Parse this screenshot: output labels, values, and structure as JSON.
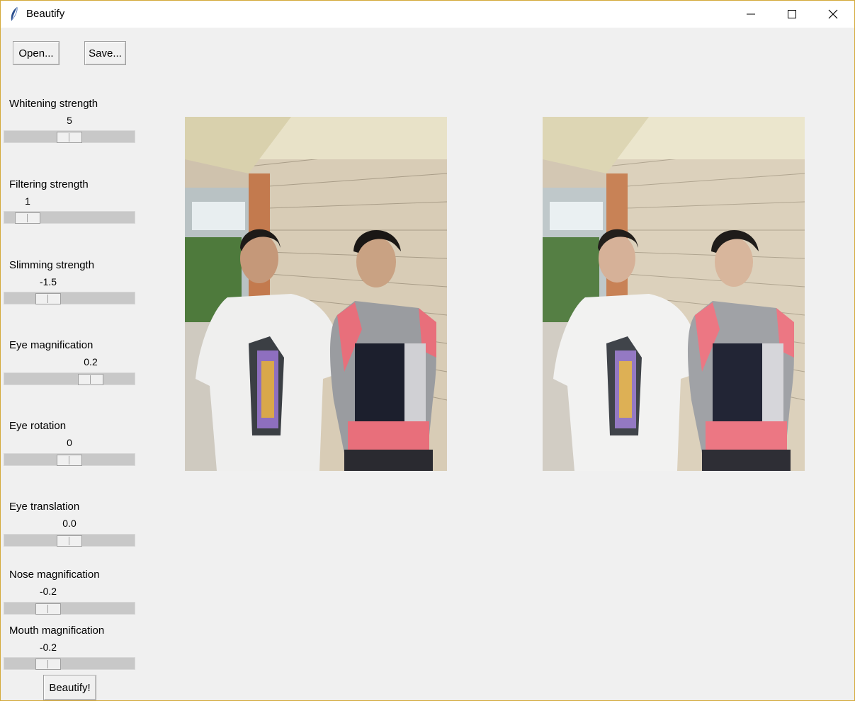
{
  "window": {
    "title": "Beautify"
  },
  "icons": {
    "app": "feather-icon",
    "minimize": "minimize-icon",
    "maximize": "maximize-icon",
    "close": "close-icon"
  },
  "toolbar": {
    "open_label": "Open...",
    "save_label": "Save..."
  },
  "sliders": [
    {
      "label": "Whitening strength",
      "value": "5",
      "level": 0.5
    },
    {
      "label": "Filtering strength",
      "value": "1",
      "level": 0.1
    },
    {
      "label": "Slimming strength",
      "value": "-1.5",
      "level": 0.3
    },
    {
      "label": "Eye magnification",
      "value": "0.2",
      "level": 0.7
    },
    {
      "label": "Eye rotation",
      "value": "0",
      "level": 0.5
    },
    {
      "label": "Eye translation",
      "value": "0.0",
      "level": 0.5
    },
    {
      "label": "Nose magnification",
      "value": "-0.2",
      "level": 0.3
    },
    {
      "label": "Mouth magnification",
      "value": "-0.2",
      "level": 0.3
    }
  ],
  "actions": {
    "beautify_label": "Beautify!"
  }
}
